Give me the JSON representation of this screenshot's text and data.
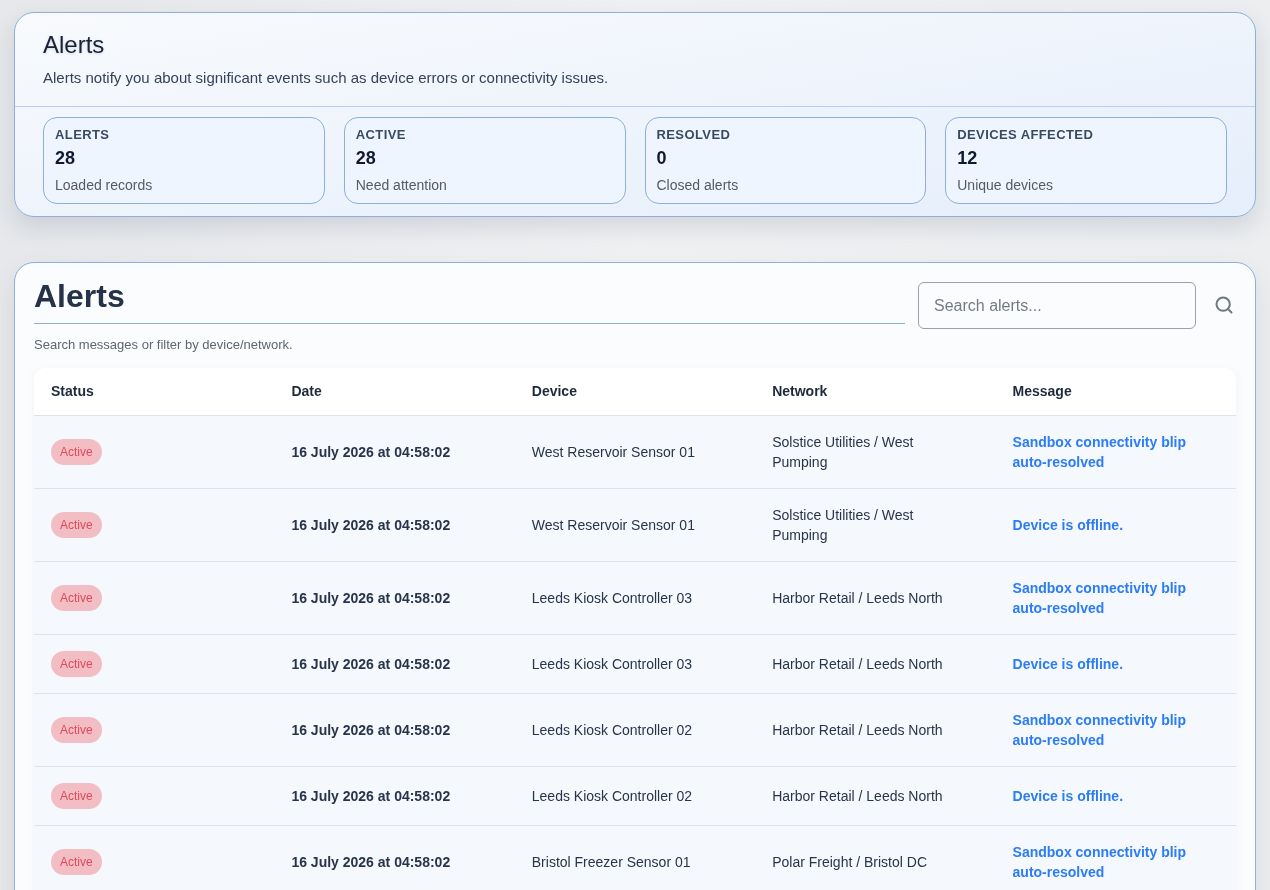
{
  "summary": {
    "title": "Alerts",
    "description": "Alerts notify you about significant events such as device errors or connectivity issues.",
    "stats": [
      {
        "label": "ALERTS",
        "value": "28",
        "caption": "Loaded records"
      },
      {
        "label": "ACTIVE",
        "value": "28",
        "caption": "Need attention"
      },
      {
        "label": "RESOLVED",
        "value": "0",
        "caption": "Closed alerts"
      },
      {
        "label": "DEVICES AFFECTED",
        "value": "12",
        "caption": "Unique devices"
      }
    ]
  },
  "alerts_panel": {
    "title": "Alerts",
    "search": {
      "placeholder": "Search alerts..."
    },
    "hint": "Search messages or filter by device/network.",
    "table": {
      "columns": [
        "Status",
        "Date",
        "Device",
        "Network",
        "Message"
      ],
      "rows": [
        {
          "status": "Active",
          "date": "16 July 2026 at 04:58:02",
          "device": "West Reservoir Sensor 01",
          "network": "Solstice Utilities / West Pumping",
          "message": "Sandbox connectivity blip auto-resolved"
        },
        {
          "status": "Active",
          "date": "16 July 2026 at 04:58:02",
          "device": "West Reservoir Sensor 01",
          "network": "Solstice Utilities / West Pumping",
          "message": "Device is offline."
        },
        {
          "status": "Active",
          "date": "16 July 2026 at 04:58:02",
          "device": "Leeds Kiosk Controller 03",
          "network": "Harbor Retail / Leeds North",
          "message": "Sandbox connectivity blip auto-resolved"
        },
        {
          "status": "Active",
          "date": "16 July 2026 at 04:58:02",
          "device": "Leeds Kiosk Controller 03",
          "network": "Harbor Retail / Leeds North",
          "message": "Device is offline."
        },
        {
          "status": "Active",
          "date": "16 July 2026 at 04:58:02",
          "device": "Leeds Kiosk Controller 02",
          "network": "Harbor Retail / Leeds North",
          "message": "Sandbox connectivity blip auto-resolved"
        },
        {
          "status": "Active",
          "date": "16 July 2026 at 04:58:02",
          "device": "Leeds Kiosk Controller 02",
          "network": "Harbor Retail / Leeds North",
          "message": "Device is offline."
        },
        {
          "status": "Active",
          "date": "16 July 2026 at 04:58:02",
          "device": "Bristol Freezer Sensor 01",
          "network": "Polar Freight / Bristol DC",
          "message": "Sandbox connectivity blip auto-resolved"
        }
      ]
    }
  }
}
